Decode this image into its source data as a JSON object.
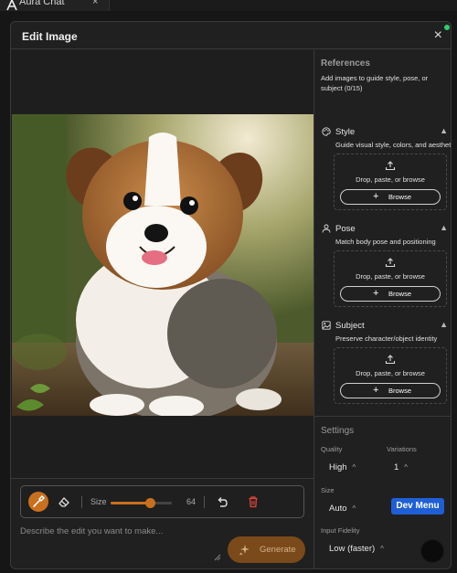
{
  "browser": {
    "tab_title": "Aura Chat",
    "tab_close": "×"
  },
  "modal": {
    "title": "Edit Image",
    "close": "×"
  },
  "toolbar": {
    "size_label": "Size",
    "size_value": "64",
    "size_fraction": 0.64
  },
  "prompt": {
    "placeholder": "Describe the edit you want to make...",
    "value": ""
  },
  "generate": {
    "label": "Generate"
  },
  "references": {
    "title": "References",
    "description": "Add images to guide style, pose, or subject (0/15)",
    "sections": [
      {
        "name": "Style",
        "icon": "palette-icon",
        "desc": "Guide visual style, colors, and aesthetic",
        "drop": "Drop, paste, or browse",
        "browse": "Browse"
      },
      {
        "name": "Pose",
        "icon": "person-icon",
        "desc": "Match body pose and positioning",
        "drop": "Drop, paste, or browse",
        "browse": "Browse"
      },
      {
        "name": "Subject",
        "icon": "image-icon",
        "desc": "Preserve character/object identity",
        "drop": "Drop, paste, or browse",
        "browse": "Browse"
      }
    ]
  },
  "settings": {
    "title": "Settings",
    "quality": {
      "label": "Quality",
      "value": "High"
    },
    "variations": {
      "label": "Variations",
      "value": "1"
    },
    "size": {
      "label": "Size",
      "value": "Auto"
    },
    "input_fidelity": {
      "label": "Input Fidelity",
      "value": "Low (faster)"
    }
  },
  "dev_menu": {
    "label": "Dev Menu"
  },
  "colors": {
    "accent": "#c9701e",
    "generate_bg": "#7a4a1a",
    "dev_menu": "#1f5fd6",
    "status": "#2ecc71"
  }
}
